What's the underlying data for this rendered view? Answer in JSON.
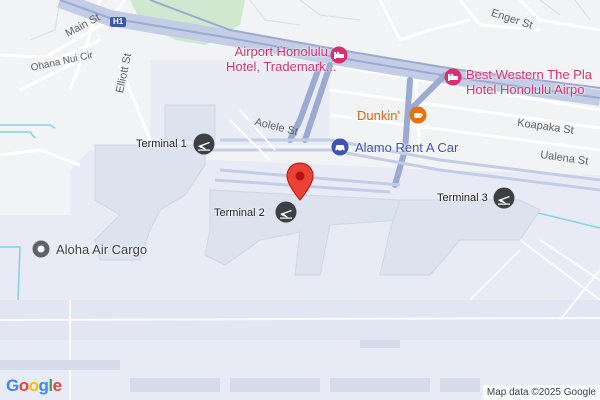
{
  "map": {
    "highway_shield": "H1",
    "streets": {
      "main_st": "Main St",
      "ohana_nui_cir": "Ohana Nui Cir",
      "elliott_st": "Elliott St",
      "enger_st": "Enger St",
      "aolele_st": "Aolele St",
      "koapaka_st": "Koapaka St",
      "ualena_st": "Ualena St"
    },
    "places": {
      "airport_hotel_line1": "Airport Honolulu",
      "airport_hotel_line2": "Hotel, Trademark...",
      "best_western_line1": "Best Western The Pla",
      "best_western_line2": "Hotel Honolulu Airpo",
      "dunkin": "Dunkin'",
      "alamo": "Alamo Rent A Car",
      "aloha_air_cargo": "Aloha Air Cargo",
      "terminal_1": "Terminal 1",
      "terminal_2": "Terminal 2",
      "terminal_3": "Terminal 3"
    },
    "icons": {
      "hotel": "hotel-icon",
      "coffee": "coffee-icon",
      "car_rental": "car-rental-icon",
      "airport_terminal": "airport-terminal-icon",
      "cargo": "pin-icon",
      "marker": "red-location-marker"
    },
    "colors": {
      "hotel_pink": "#d6306f",
      "car_blue": "#3f51b5",
      "coffee_orange": "#e8710a",
      "marker_red": "#ea4335",
      "water_lines": "#7fd3e6",
      "airport_area": "#e8ebf5",
      "road_blue": "#8fa1c9"
    },
    "logo_text": "Google",
    "attribution": "Map data ©2025 Google"
  }
}
